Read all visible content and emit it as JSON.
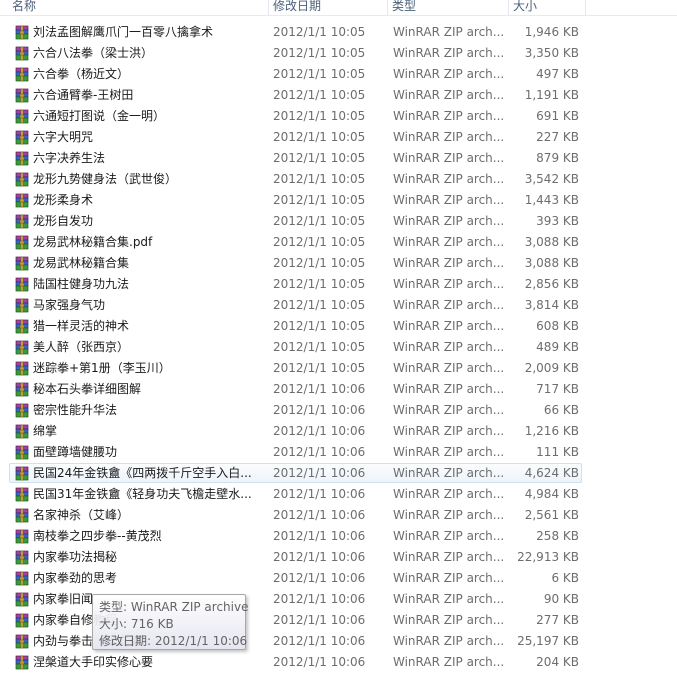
{
  "columns": {
    "name": "名称",
    "date": "修改日期",
    "type": "类型",
    "size": "大小"
  },
  "icon": "winrar-archive-icon",
  "rows": [
    {
      "name": "刘法孟图解鹰爪门一百零八擒拿术",
      "date": "2012/1/1 10:05",
      "type": "WinRAR ZIP arch...",
      "size": "1,946 KB"
    },
    {
      "name": "六合八法拳（梁士洪）",
      "date": "2012/1/1 10:05",
      "type": "WinRAR ZIP arch...",
      "size": "3,350 KB"
    },
    {
      "name": "六合拳（杨近文）",
      "date": "2012/1/1 10:05",
      "type": "WinRAR ZIP arch...",
      "size": "497 KB"
    },
    {
      "name": "六合通臂拳-王树田",
      "date": "2012/1/1 10:05",
      "type": "WinRAR ZIP arch...",
      "size": "1,191 KB"
    },
    {
      "name": "六通短打图说（金一明）",
      "date": "2012/1/1 10:05",
      "type": "WinRAR ZIP arch...",
      "size": "691 KB"
    },
    {
      "name": "六字大明咒",
      "date": "2012/1/1 10:05",
      "type": "WinRAR ZIP arch...",
      "size": "227 KB"
    },
    {
      "name": "六字决养生法",
      "date": "2012/1/1 10:05",
      "type": "WinRAR ZIP arch...",
      "size": "879 KB"
    },
    {
      "name": "龙形九势健身法（武世俊）",
      "date": "2012/1/1 10:05",
      "type": "WinRAR ZIP arch...",
      "size": "3,542 KB"
    },
    {
      "name": "龙形柔身术",
      "date": "2012/1/1 10:05",
      "type": "WinRAR ZIP arch...",
      "size": "1,443 KB"
    },
    {
      "name": "龙形自发功",
      "date": "2012/1/1 10:05",
      "type": "WinRAR ZIP arch...",
      "size": "393 KB"
    },
    {
      "name": "龙易武林秘籍合集.pdf",
      "date": "2012/1/1 10:05",
      "type": "WinRAR ZIP arch...",
      "size": "3,088 KB"
    },
    {
      "name": "龙易武林秘籍合集",
      "date": "2012/1/1 10:05",
      "type": "WinRAR ZIP arch...",
      "size": "3,088 KB"
    },
    {
      "name": "陆国柱健身功九法",
      "date": "2012/1/1 10:05",
      "type": "WinRAR ZIP arch...",
      "size": "2,856 KB"
    },
    {
      "name": "马家强身气功",
      "date": "2012/1/1 10:05",
      "type": "WinRAR ZIP arch...",
      "size": "3,814 KB"
    },
    {
      "name": "猎一样灵活的神术",
      "date": "2012/1/1 10:05",
      "type": "WinRAR ZIP arch...",
      "size": "608 KB"
    },
    {
      "name": "美人醉（张西京）",
      "date": "2012/1/1 10:05",
      "type": "WinRAR ZIP arch...",
      "size": "489 KB"
    },
    {
      "name": "迷踪拳+第1册（李玉川）",
      "date": "2012/1/1 10:05",
      "type": "WinRAR ZIP arch...",
      "size": "2,009 KB"
    },
    {
      "name": "秘本石头拳详细图解",
      "date": "2012/1/1 10:06",
      "type": "WinRAR ZIP arch...",
      "size": "717 KB"
    },
    {
      "name": "密宗性能升华法",
      "date": "2012/1/1 10:06",
      "type": "WinRAR ZIP arch...",
      "size": "66 KB"
    },
    {
      "name": "绵掌",
      "date": "2012/1/1 10:06",
      "type": "WinRAR ZIP arch...",
      "size": "1,216 KB"
    },
    {
      "name": "面壁蹲墙健腰功",
      "date": "2012/1/1 10:06",
      "type": "WinRAR ZIP arch...",
      "size": "111 KB"
    },
    {
      "name": "民国24年金铁盦《四两拨千斤空手入白...",
      "date": "2012/1/1 10:06",
      "type": "WinRAR ZIP arch...",
      "size": "4,624 KB",
      "selected": true
    },
    {
      "name": "民国31年金铁盦《轻身功夫飞檐走壁水...",
      "date": "2012/1/1 10:06",
      "type": "WinRAR ZIP arch...",
      "size": "4,984 KB"
    },
    {
      "name": "名家神杀（艾峰）",
      "date": "2012/1/1 10:06",
      "type": "WinRAR ZIP arch...",
      "size": "2,561 KB"
    },
    {
      "name": "南枝拳之四步拳--黄茂烈",
      "date": "2012/1/1 10:06",
      "type": "WinRAR ZIP arch...",
      "size": "258 KB"
    },
    {
      "name": "内家拳功法揭秘",
      "date": "2012/1/1 10:06",
      "type": "WinRAR ZIP arch...",
      "size": "22,913 KB"
    },
    {
      "name": "内家拳劲的思考",
      "date": "2012/1/1 10:06",
      "type": "WinRAR ZIP arch...",
      "size": "6 KB"
    },
    {
      "name": "内家拳旧闻",
      "date": "2012/1/1 10:06",
      "type": "WinRAR ZIP arch...",
      "size": "90 KB"
    },
    {
      "name": "内家拳自修教程",
      "date": "2012/1/1 10:06",
      "type": "WinRAR ZIP arch...",
      "size": "277 KB"
    },
    {
      "name": "内劲与拳击（张立德）",
      "date": "2012/1/1 10:06",
      "type": "WinRAR ZIP arch...",
      "size": "25,197 KB"
    },
    {
      "name": "涅槃道大手印实修心要",
      "date": "2012/1/1 10:06",
      "type": "WinRAR ZIP arch...",
      "size": "204 KB"
    }
  ],
  "tooltip": {
    "type_line": "类型: WinRAR ZIP archive",
    "size_line": "大小: 716 KB",
    "date_line": "修改日期: 2012/1/1 10:06"
  }
}
